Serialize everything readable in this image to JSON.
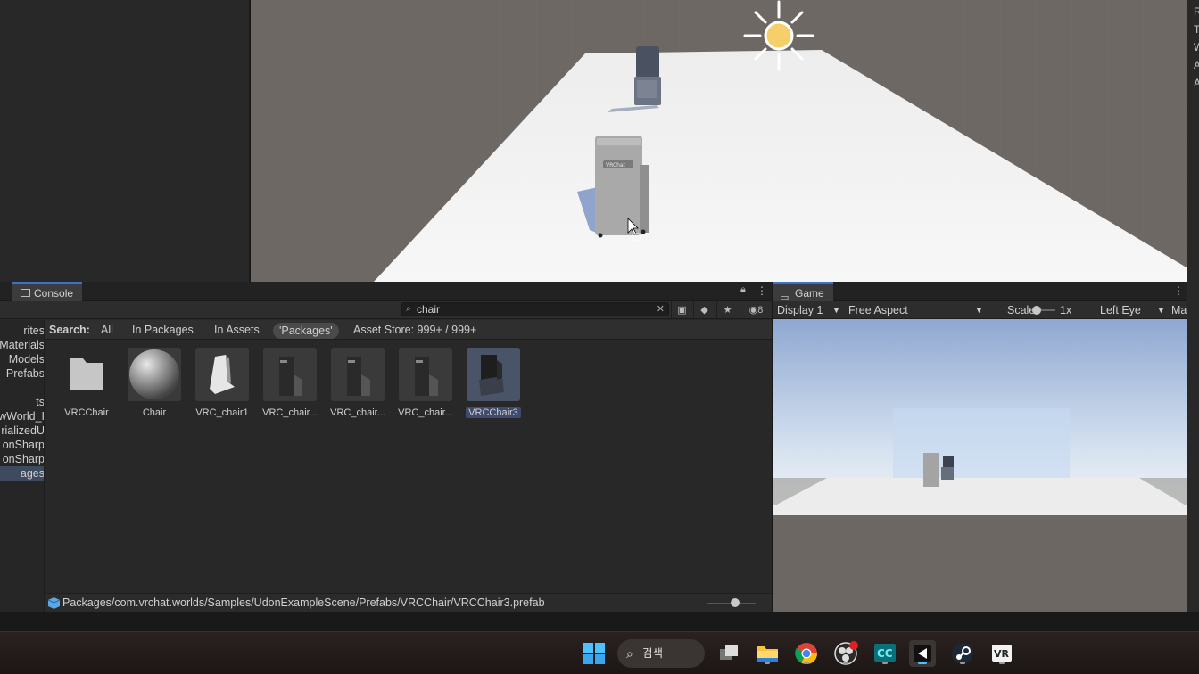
{
  "hierarchy_tree": [
    {
      "label": "rites",
      "sel": false
    },
    {
      "label": "Materials",
      "sel": false
    },
    {
      "label": "Models",
      "sel": false
    },
    {
      "label": "Prefabs",
      "sel": false
    },
    {
      "label": "",
      "sel": false
    },
    {
      "label": "ts",
      "sel": false
    },
    {
      "label": "wWorld_I",
      "sel": false
    },
    {
      "label": "rializedU",
      "sel": false
    },
    {
      "label": "onSharp",
      "sel": false
    },
    {
      "label": "onSharp",
      "sel": false
    },
    {
      "label": "ages",
      "sel": true
    }
  ],
  "inspector": {
    "letters": [
      "R",
      "T",
      "W",
      "A",
      "A"
    ]
  },
  "project_panel": {
    "tab_label": "Console",
    "search_value": "chair",
    "hidden_count": "8",
    "filter": {
      "search_label": "Search:",
      "all": "All",
      "in_packages": "In Packages",
      "in_assets": "In Assets",
      "packages": "'Packages'",
      "asset_store": "Asset Store: 999+ / 999+"
    },
    "assets": [
      {
        "name": "VRCChair",
        "kind": "folder"
      },
      {
        "name": "Chair",
        "kind": "material"
      },
      {
        "name": "VRC_chair1",
        "kind": "mesh"
      },
      {
        "name": "VRC_chair...",
        "kind": "prefab"
      },
      {
        "name": "VRC_chair...",
        "kind": "prefab"
      },
      {
        "name": "VRC_chair...",
        "kind": "prefab"
      },
      {
        "name": "VRCChair3",
        "kind": "prefab-selected"
      }
    ],
    "selected_path": "Packages/com.vrchat.worlds/Samples/UdonExampleScene/Prefabs/VRCChair/VRCChair3.prefab",
    "thumb_size": 0.55
  },
  "game_panel": {
    "tab_label": "Game",
    "display": "Display 1",
    "aspect": "Free Aspect",
    "scale_label": "Scale",
    "scale_value": "1x",
    "eye": "Left Eye",
    "extra": "Ma"
  },
  "scene": {
    "chair_sign": "VRChat"
  },
  "taskbar": {
    "search_label": "검색",
    "apps": [
      "windows-start",
      "task-view",
      "file-explorer",
      "chrome",
      "obs",
      "creator-companion",
      "unity",
      "steam",
      "vr"
    ]
  },
  "colors": {
    "accent": "#3a72c8",
    "panel": "#282828",
    "sky": "#9bb4dc",
    "ground": "#6d6763"
  }
}
